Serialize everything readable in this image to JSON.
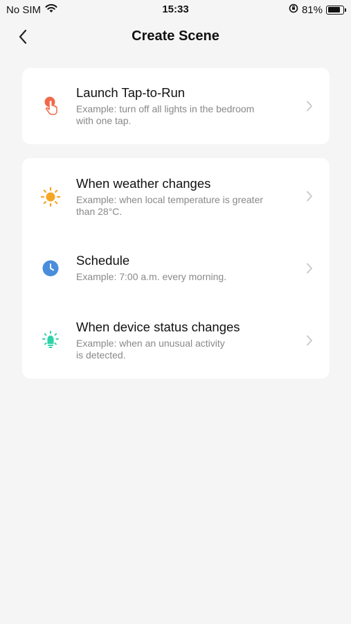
{
  "status_bar": {
    "carrier": "No SIM",
    "time": "15:33",
    "battery_percent": "81%",
    "battery_level": 0.81
  },
  "nav": {
    "title": "Create Scene"
  },
  "tap_to_run": {
    "label": "Launch Tap-to-Run",
    "desc_line1": "Example: turn off all lights in the bedroom",
    "desc_line2": "with one tap.",
    "icon": "tap-hand-icon",
    "color": "#f06a4a"
  },
  "conditions": [
    {
      "label": "When weather changes",
      "desc_line1": "Example: when local temperature is greater",
      "desc_line2": "than 28°C.",
      "icon": "sun-icon",
      "color": "#f5a623"
    },
    {
      "label": "Schedule",
      "desc_line1": "Example: 7:00 a.m. every morning.",
      "desc_line2": "",
      "icon": "clock-icon",
      "color": "#4a8ddc"
    },
    {
      "label": "When device status changes",
      "desc_line1": "Example: when an unusual activity",
      "desc_line2": "is detected.",
      "icon": "device-bulb-icon",
      "color": "#2ed3a6"
    }
  ]
}
